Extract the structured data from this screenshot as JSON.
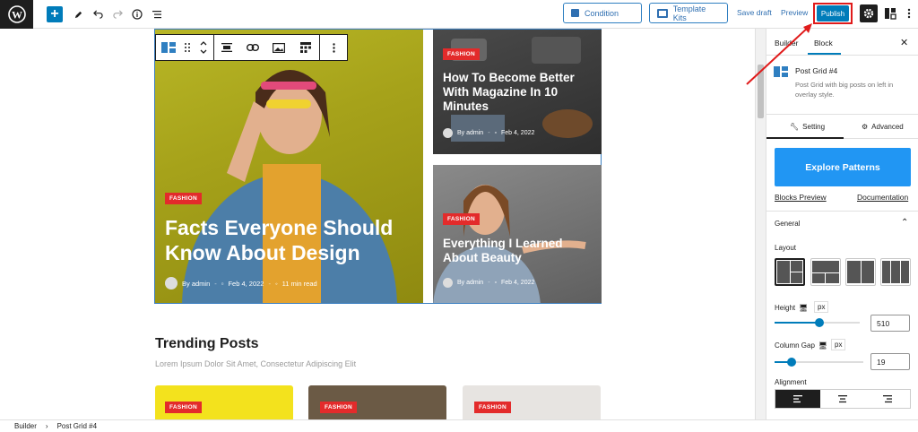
{
  "toolbar": {
    "condition_label": "Condition",
    "template_kits_label": "Template Kits",
    "save_draft_label": "Save draft",
    "preview_label": "Preview",
    "publish_label": "Publish"
  },
  "post_grid": {
    "big": {
      "badge": "FASHION",
      "title": "Facts Everyone Should Know About Design",
      "author": "By admin",
      "date": "Feb 4, 2022",
      "read": "11 min read"
    },
    "small1": {
      "badge": "FASHION",
      "title": "How To Become Better With Magazine In 10 Minutes",
      "author": "By admin",
      "date": "Feb 4, 2022"
    },
    "small2": {
      "badge": "FASHION",
      "title": "Everything I Learned About Beauty",
      "author": "By admin",
      "date": "Feb 4, 2022"
    }
  },
  "trending": {
    "title": "Trending Posts",
    "subtitle": "Lorem Ipsum Dolor Sit Amet, Consectetur Adipiscing Elit",
    "cards": [
      {
        "badge": "FASHION"
      },
      {
        "badge": "FASHION"
      },
      {
        "badge": "FASHION"
      }
    ]
  },
  "sidebar": {
    "tab_builder": "Builder",
    "tab_block": "Block",
    "block_name": "Post Grid #4",
    "block_desc": "Post Grid with big posts on left in overlay style.",
    "tab_setting": "Setting",
    "tab_advanced": "Advanced",
    "explore_label": "Explore Patterns",
    "blocks_preview_label": "Blocks Preview",
    "documentation_label": "Documentation",
    "general_label": "General",
    "layout_label": "Layout",
    "height_label": "Height",
    "height_unit": "px",
    "height_value": "510",
    "column_gap_label": "Column Gap",
    "column_gap_unit": "px",
    "column_gap_value": "19",
    "alignment_label": "Alignment"
  },
  "footer": {
    "crumb1": "Builder",
    "sep": "›",
    "crumb2": "Post Grid #4"
  },
  "colors": {
    "accent": "#007cba",
    "explore": "#2196f3",
    "badge": "#e32b2b",
    "highlight": "#e01b1b"
  }
}
